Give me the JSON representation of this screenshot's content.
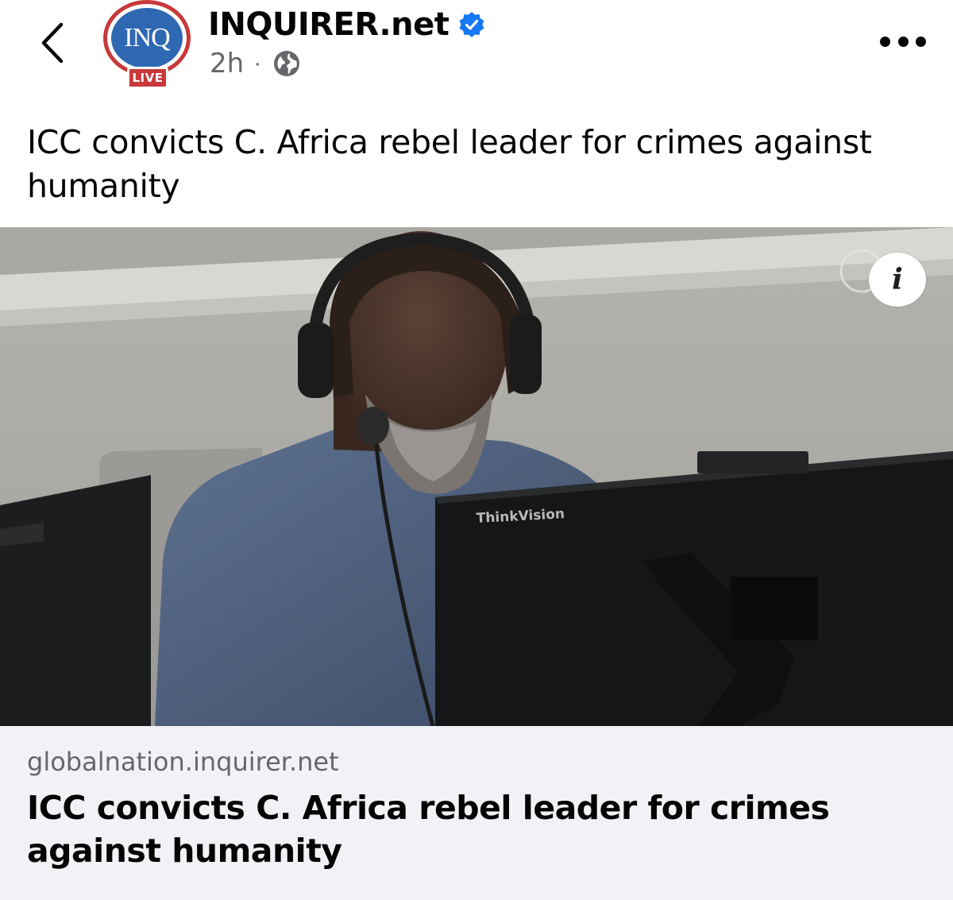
{
  "header": {
    "back_icon": "chevron-left-icon",
    "avatar_text": "INQ",
    "live_badge": "LIVE",
    "page_name": "INQUIRER.net",
    "verified_icon": "verified-badge-icon",
    "time": "2h",
    "separator": "·",
    "audience_icon": "globe-icon",
    "more_icon": "more-options-icon",
    "colors": {
      "brand_red": "#c9383a",
      "brand_blue": "#2f68b2",
      "verified_blue": "#1877f2",
      "meta_gray": "#65676b"
    }
  },
  "post": {
    "caption": "ICC convicts C. Africa rebel leader for crimes against humanity"
  },
  "media": {
    "info_icon_glyph": "i",
    "monitor_brand": "ThinkVision"
  },
  "link_preview": {
    "domain": "globalnation.inquirer.net",
    "title": "ICC convicts C. Africa rebel leader for crimes against humanity",
    "background": "#f0f2f5"
  }
}
